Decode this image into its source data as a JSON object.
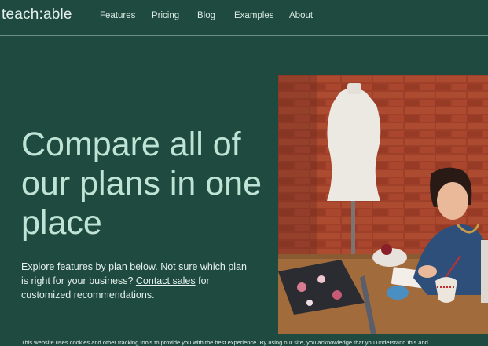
{
  "header": {
    "logo": "teach:able",
    "nav": [
      "Features",
      "Pricing",
      "Blog",
      "Examples",
      "About"
    ]
  },
  "hero": {
    "title": "Compare all of our plans in one place",
    "subtitle_before": "Explore features by plan below. Not sure which plan is right for your business? ",
    "contact_link": "Contact sales",
    "subtitle_after": " for customized recommendations."
  },
  "cookie_banner": {
    "text": "This website uses cookies and other tracking tools to provide you with the best experience. By using our site, you acknowledge that you understand this and"
  },
  "colors": {
    "background": "#1e4a3f",
    "title": "#bfe3d4",
    "text": "#e6f0ec"
  }
}
